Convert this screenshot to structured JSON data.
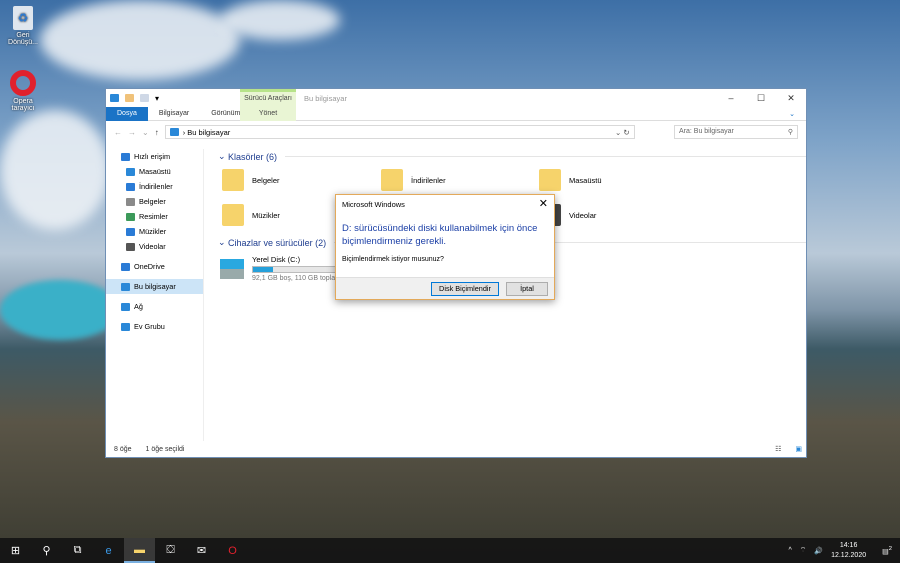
{
  "desktop": {
    "icons": [
      {
        "label": "Geri Dönüşü..."
      },
      {
        "label": "Opera tarayıcı"
      }
    ]
  },
  "explorer": {
    "title": "Bu bilgisayar",
    "context_tab": {
      "group": "Sürücü Araçları",
      "tab": "Yönet"
    },
    "tabs": [
      "Dosya",
      "Bilgisayar",
      "Görünüm"
    ],
    "address": "Bu bilgisayar",
    "search_placeholder": "Ara: Bu bilgisayar",
    "nav": [
      {
        "label": "Hızlı erişim",
        "color": "#2a7bd6"
      },
      {
        "label": "Masaüstü",
        "color": "#2a88d8"
      },
      {
        "label": "İndirilenler",
        "color": "#2a7bd6"
      },
      {
        "label": "Belgeler",
        "color": "#8a8a8a"
      },
      {
        "label": "Resimler",
        "color": "#3c9a5a"
      },
      {
        "label": "Müzikler",
        "color": "#2a7bd6"
      },
      {
        "label": "Videolar",
        "color": "#555"
      },
      {
        "label": "OneDrive",
        "color": "#2a7bd6"
      },
      {
        "label": "Bu bilgisayar",
        "color": "#2a88d8"
      },
      {
        "label": "Ağ",
        "color": "#2a88d8"
      },
      {
        "label": "Ev Grubu",
        "color": "#2a88d8"
      }
    ],
    "folders_header": "Klasörler (6)",
    "folders": [
      "Belgeler",
      "İndirilenler",
      "Masaüstü",
      "Müzikler",
      "Videolar"
    ],
    "devices_header": "Cihazlar ve sürücüler (2)",
    "drive": {
      "name": "Yerel Disk (C:)",
      "info": "92,1 GB boş, 110 GB toplam",
      "used_fraction": 0.16
    },
    "status": {
      "count": "8 öğe",
      "selected": "1 öğe seçildi"
    }
  },
  "dialog": {
    "title": "Microsoft Windows",
    "message": "D: sürücüsündeki diski kullanabilmek için önce biçimlendirmeniz gerekli.",
    "question": "Biçimlendirmek istiyor musunuz?",
    "ok": "Disk Biçimlendir",
    "cancel": "İptal"
  },
  "taskbar": {
    "time": "14:16",
    "date": "12.12.2020",
    "notifications": "2"
  }
}
